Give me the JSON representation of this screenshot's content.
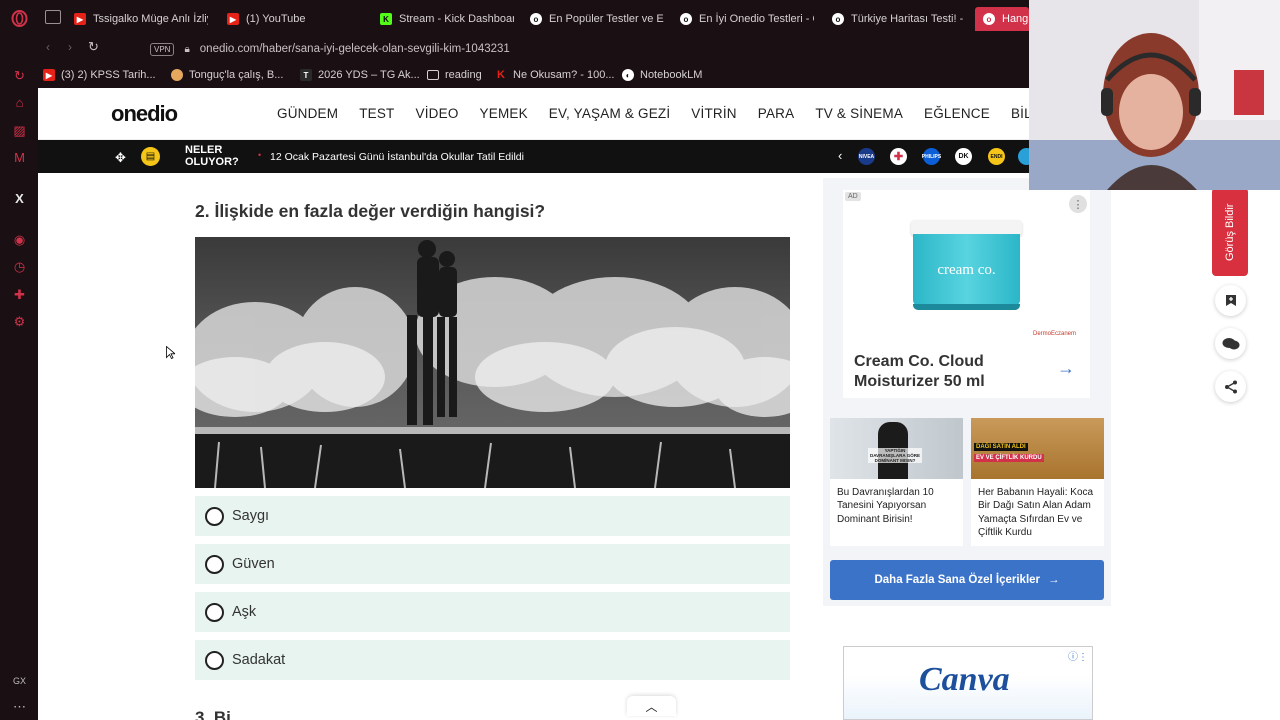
{
  "browser": {
    "accent": "#d2314a",
    "tabs": [
      {
        "label": "Tssigalko Müge Anlı İzliy",
        "icon": "youtube-icon",
        "color": "#e62117"
      },
      {
        "label": "(1) YouTube",
        "icon": "youtube-icon",
        "color": "#e62117"
      },
      {
        "label": "Stream - Kick Dashboar",
        "icon": "kick-icon",
        "color": "#53fc18"
      },
      {
        "label": "En Popüler Testler ve E",
        "icon": "onedio-icon",
        "color": "#ffffff"
      },
      {
        "label": "En İyi Onedio Testleri - O",
        "icon": "onedio-icon",
        "color": "#ffffff"
      },
      {
        "label": "Türkiye Haritası Testi! -",
        "icon": "onedio-icon",
        "color": "#ffffff"
      },
      {
        "label": "Hangi",
        "icon": "onedio-icon",
        "color": "#ffffff"
      }
    ],
    "vpn_label": "VPN",
    "url": "onedio.com/haber/sana-iyi-gelecek-olan-sevgili-kim-1043231",
    "bookmarks": [
      {
        "label": "(3) 2) KPSS Tarih...",
        "icon": "youtube-icon"
      },
      {
        "label": "Tonguç'la çalış, B...",
        "icon": "tonguc-icon"
      },
      {
        "label": "2026 YDS – TG Ak...",
        "icon": "tg-icon"
      },
      {
        "label": "reading",
        "icon": "folder-icon"
      },
      {
        "label": "Ne Okusam? - 100...",
        "icon": "kindle-icon"
      },
      {
        "label": "NotebookLM",
        "icon": "notebooklm-icon"
      }
    ],
    "gx_label": "GX"
  },
  "site": {
    "logo": "onedio",
    "nav": [
      "GÜNDEM",
      "TEST",
      "VİDEO",
      "YEMEK",
      "EV, YAŞAM & GEZİ",
      "VİTRİN",
      "PARA",
      "TV & SİNEMA",
      "EĞLENCE",
      "BİLGİSA"
    ],
    "ticker": {
      "heading_line1": "NELER",
      "heading_line2": "OLUYOR?",
      "headline": "12 Ocak Pazartesi Günü İstanbul'da Okullar Tatil Edildi",
      "brands": [
        "NIVEA",
        "",
        "PHILIPS",
        "DK",
        "ENDI",
        ""
      ]
    }
  },
  "quiz": {
    "question": "2. İlişkide en fazla değer verdiğin hangisi?",
    "options": [
      "Saygı",
      "Güven",
      "Aşk",
      "Sadakat"
    ],
    "next_question_partial": "3. Bi"
  },
  "sidebar": {
    "ad_badge": "AD",
    "ad_product_label": "cream co.",
    "ad_title": "Cream Co. Cloud Moisturizer 50 ml",
    "ad_seller": "DermoEczanem",
    "recommendations": [
      {
        "title": "Bu Davranışlardan 10 Tanesini Yapıyorsan Dominant Birisin!",
        "thumb_text": "YAPTIĞIN DAVRANIŞLARA GÖRE DOMİNANT MISIN?"
      },
      {
        "title": "Her Babanın Hayali: Koca Bir Dağı Satın Alan Adam Yamaçta Sıfırdan Ev ve Çiftlik Kurdu",
        "thumb_text_1": "DAĞI SATIN ALDI",
        "thumb_text_2": "EV VE ÇİFTLİK KURDU"
      }
    ],
    "more_button": "Daha Fazla Sana Özel İçerikler",
    "canva_logo": "Canva"
  },
  "floating": {
    "feedback_label": "Görüş Bildir"
  }
}
